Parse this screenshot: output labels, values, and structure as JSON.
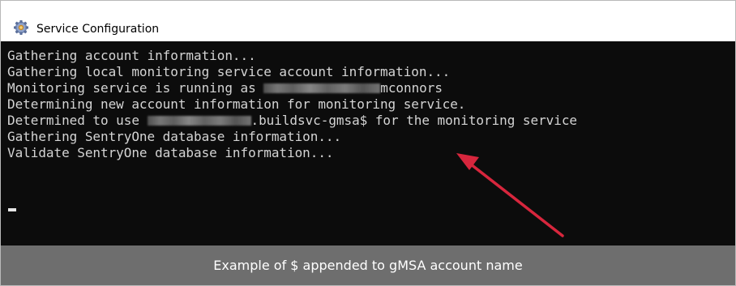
{
  "window": {
    "title": "Service Configuration",
    "icon": "gear-icon"
  },
  "console": {
    "lines": [
      {
        "before": "Gathering account information...",
        "after": ""
      },
      {
        "before": "Gathering local monitoring service account information...",
        "after": ""
      },
      {
        "before": "Monitoring service is running as ",
        "after": "mconnors"
      },
      {
        "before": "Determining new account information for monitoring service.",
        "after": ""
      },
      {
        "before": "Determined to use ",
        "after": ".buildsvc-gmsa$ for the monitoring service"
      },
      {
        "before": "Gathering SentryOne database information...",
        "after": ""
      },
      {
        "before": "Validate SentryOne database information...",
        "after": ""
      }
    ],
    "text_color": "#d4d4d4",
    "background": "#0c0c0c"
  },
  "annotation": {
    "arrow_color": "#d7263d"
  },
  "caption": {
    "text": "Example of $ appended to gMSA account name"
  }
}
